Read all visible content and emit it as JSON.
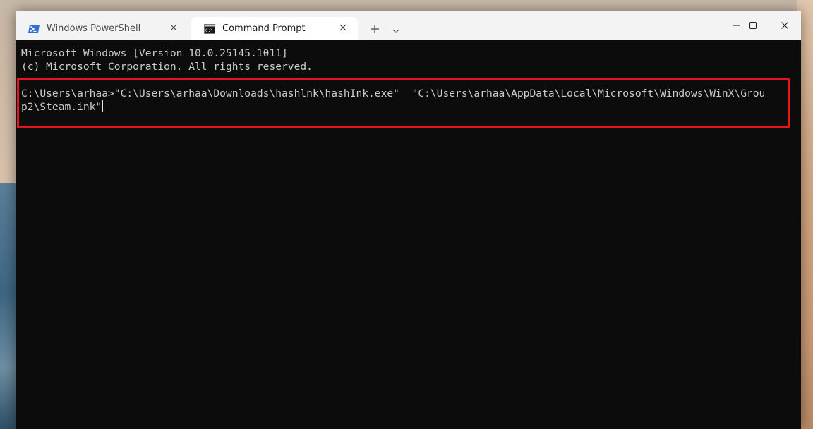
{
  "tabs": [
    {
      "label": "Windows PowerShell",
      "icon": "powershell-icon",
      "active": false
    },
    {
      "label": "Command Prompt",
      "icon": "cmd-icon",
      "active": true
    }
  ],
  "titlebar": {
    "new_tab_icon": "plus-icon",
    "dropdown_icon": "chevron-down-icon",
    "window_controls": [
      "minimize-icon",
      "maximize-icon",
      "close-icon"
    ]
  },
  "terminal": {
    "lines": [
      "Microsoft Windows [Version 10.0.25145.1011]",
      "(c) Microsoft Corporation. All rights reserved.",
      "C:\\Users\\arhaa>\"C:\\Users\\arhaa\\Downloads\\hashlnk\\hashInk.exe\"  \"C:\\Users\\arhaa\\AppData\\Local\\Microsoft\\Windows\\WinX\\Grou",
      "p2\\Steam.ink\""
    ]
  },
  "colors": {
    "terminal_bg": "#0c0c0c",
    "terminal_text": "#cccccc",
    "highlight_border": "#e8131d",
    "titlebar_bg": "#f3f3f3"
  }
}
